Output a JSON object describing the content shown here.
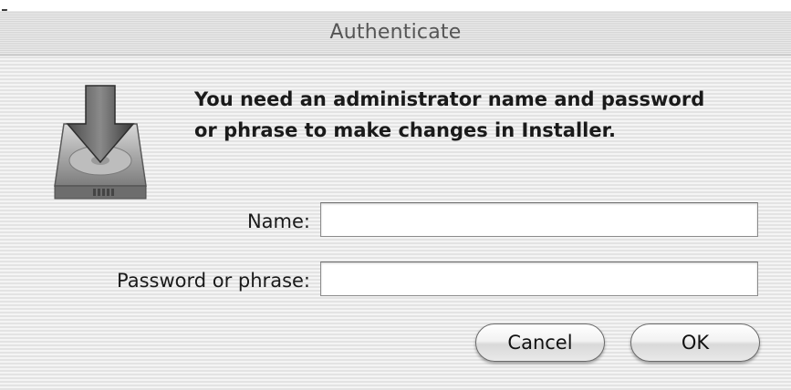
{
  "window": {
    "title": "Authenticate"
  },
  "message": {
    "line1": "You need an administrator name and password",
    "line2": "or phrase to make changes in Installer."
  },
  "form": {
    "name_label": "Name:",
    "name_value": "",
    "password_label": "Password or phrase:",
    "password_value": ""
  },
  "buttons": {
    "cancel_label": "Cancel",
    "ok_label": "OK"
  },
  "icons": {
    "app_icon": "installer-drive-arrow-icon"
  }
}
